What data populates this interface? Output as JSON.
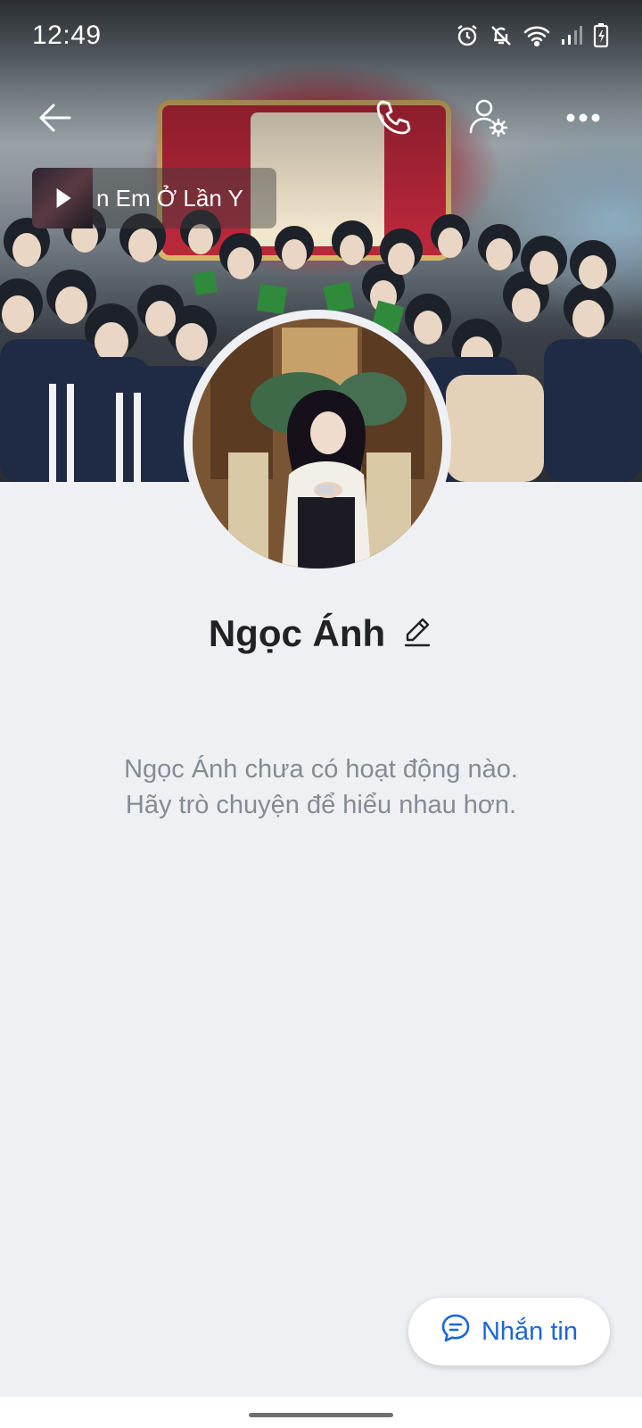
{
  "status_bar": {
    "time": "12:49",
    "icons": [
      "alarm-icon",
      "bell-off-icon",
      "wifi-icon",
      "signal-icon",
      "battery-icon"
    ]
  },
  "toolbar": {
    "back_icon": "arrow-left-icon",
    "call_icon": "phone-icon",
    "settings_icon": "user-settings-icon",
    "more_icon": "more-horizontal-icon"
  },
  "music": {
    "title": "n Em Ở Lần Y",
    "icon": "play-icon"
  },
  "profile": {
    "name": "Ngọc Ánh",
    "edit_icon": "pencil-icon"
  },
  "empty_state": {
    "line1": "Ngọc Ánh chưa có hoạt động nào.",
    "line2": "Hãy trò chuyện để hiểu nhau hơn."
  },
  "message_button": {
    "label": "Nhắn tin",
    "icon": "chat-bubble-icon"
  },
  "colors": {
    "background": "#eff0f4",
    "accent": "#1a66d9",
    "muted_text": "#858b93",
    "name_text": "#222222"
  }
}
